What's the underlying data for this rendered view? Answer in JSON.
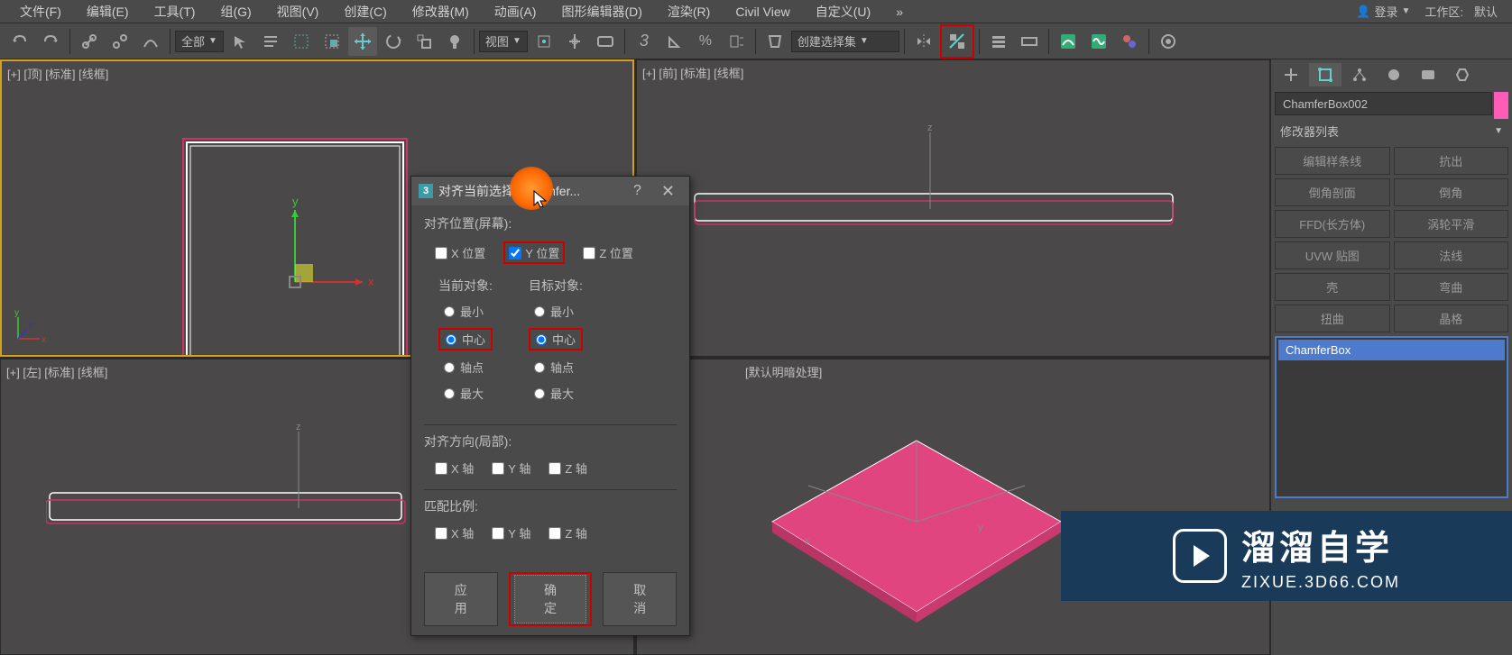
{
  "menubar": {
    "items": [
      "文件(F)",
      "编辑(E)",
      "工具(T)",
      "组(G)",
      "视图(V)",
      "创建(C)",
      "修改器(M)",
      "动画(A)",
      "图形编辑器(D)",
      "渲染(R)",
      "Civil View",
      "自定义(U)"
    ],
    "login": "登录",
    "workspace_label": "工作区:",
    "workspace_value": "默认"
  },
  "toolbar": {
    "filter_label": "全部",
    "view_label": "视图",
    "selset_label": "创建选择集"
  },
  "viewports": {
    "top": "[+] [顶] [标准] [线框]",
    "front": "[+] [前] [标准] [线框]",
    "left": "[+] [左] [标准] [线框]",
    "persp": "[默认明暗处理]"
  },
  "right_panel": {
    "obj_name": "ChamferBox002",
    "modifier_list": "修改器列表",
    "buttons": [
      "编辑样条线",
      "抗出",
      "倒角剖面",
      "倒角",
      "FFD(长方体)",
      "涡轮平滑",
      "UVW 贴图",
      "法线",
      "壳",
      "弯曲",
      "扭曲",
      "晶格"
    ],
    "stack_item": "ChamferBox"
  },
  "dialog": {
    "title": "对齐当前选择 (Chamfer...",
    "section_align_pos": "对齐位置(屏幕):",
    "axis_x": "X 位置",
    "axis_y": "Y 位置",
    "axis_z": "Z 位置",
    "current_obj": "当前对象:",
    "target_obj": "目标对象:",
    "opt_min": "最小",
    "opt_center": "中心",
    "opt_pivot": "轴点",
    "opt_max": "最大",
    "section_align_dir": "对齐方向(局部):",
    "axis_x2": "X 轴",
    "axis_y2": "Y 轴",
    "axis_z2": "Z 轴",
    "section_match_scale": "匹配比例:",
    "btn_apply": "应用",
    "btn_ok": "确定",
    "btn_cancel": "取消"
  },
  "watermark": {
    "text": "溜溜自学",
    "url": "ZIXUE.3D66.COM"
  },
  "axis_labels": {
    "x": "x",
    "y": "y",
    "z": "z"
  }
}
